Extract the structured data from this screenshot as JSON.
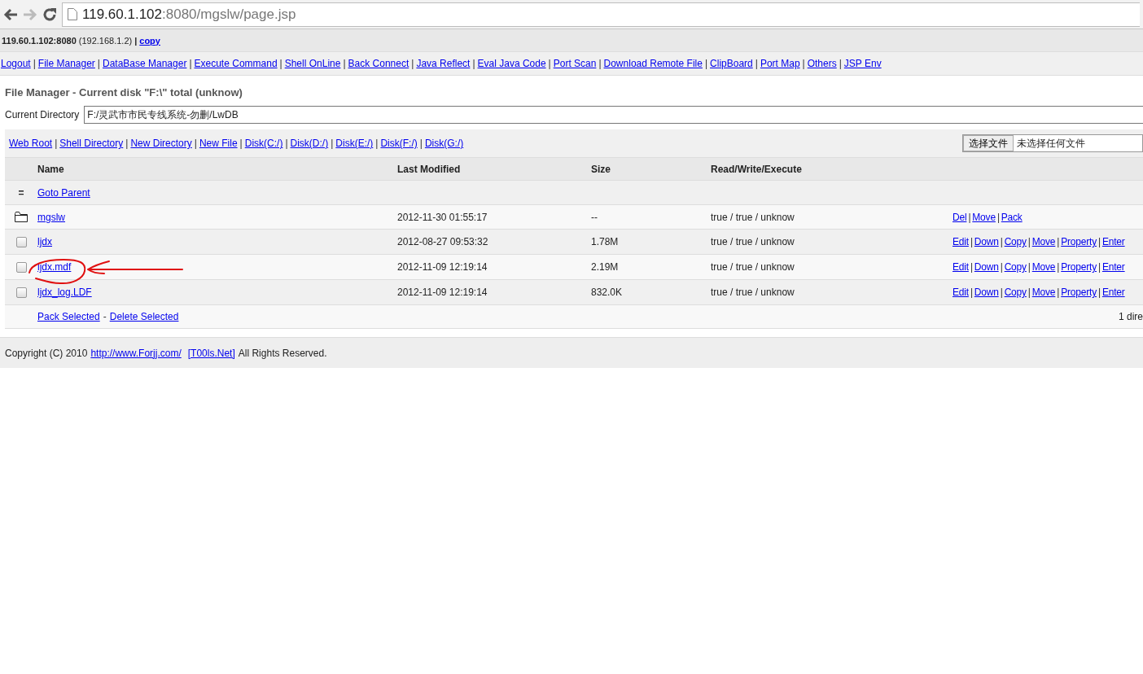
{
  "browser": {
    "url_host": "119.60.1.102",
    "url_rest": ":8080/mgslw/page.jsp"
  },
  "host_bar": {
    "host": "119.60.1.102:8080",
    "ip": "(192.168.1.2)",
    "separator": "|",
    "copy_link": "copy"
  },
  "nav": {
    "separator": "|",
    "links": [
      "Logout",
      "File Manager",
      "DataBase Manager",
      "Execute Command",
      "Shell OnLine",
      "Back Connect",
      "Java Reflect",
      "Eval Java Code",
      "Port Scan",
      "Download Remote File",
      "ClipBoard",
      "Port Map",
      "Others",
      "JSP Env"
    ]
  },
  "heading": "File Manager - Current disk \"F:\\\" total (unknow)",
  "current_directory": {
    "label": "Current Directory",
    "value": "F:/灵武市市民专线系统-勿删/LwDB"
  },
  "toolbar": {
    "separator": "|",
    "links": [
      "Web Root",
      "Shell Directory",
      "New Directory",
      "New File",
      "Disk(C:/)",
      "Disk(D:/)",
      "Disk(E:/)",
      "Disk(F:/)",
      "Disk(G:/)"
    ]
  },
  "file_picker": {
    "button": "选择文件",
    "status": "未选择任何文件"
  },
  "table": {
    "columns": [
      "Name",
      "Last Modified",
      "Size",
      "Read/Write/Execute"
    ],
    "parent_row": {
      "icon": "=",
      "label": "Goto Parent"
    },
    "action_separator": "|",
    "rows": [
      {
        "kind": "folder",
        "name": "mgslw",
        "modified": "2012-11-30 01:55:17",
        "size": "--",
        "rwx": "true / true / unknow",
        "actions": [
          "Del",
          "Move",
          "Pack"
        ],
        "annotated": false
      },
      {
        "kind": "file",
        "checked": false,
        "name": "ljdx",
        "modified": "2012-08-27 09:53:32",
        "size": "1.78M",
        "rwx": "true / true / unknow",
        "actions": [
          "Edit",
          "Down",
          "Copy",
          "Move",
          "Property",
          "Enter"
        ],
        "annotated": false
      },
      {
        "kind": "file",
        "checked": false,
        "name": "ljdx.mdf",
        "modified": "2012-11-09 12:19:14",
        "size": "2.19M",
        "rwx": "true / true / unknow",
        "actions": [
          "Edit",
          "Down",
          "Copy",
          "Move",
          "Property",
          "Enter"
        ],
        "annotated": true
      },
      {
        "kind": "file",
        "checked": false,
        "name": "ljdx_log.LDF",
        "modified": "2012-11-09 12:19:14",
        "size": "832.0K",
        "rwx": "true / true / unknow",
        "actions": [
          "Edit",
          "Down",
          "Copy",
          "Move",
          "Property",
          "Enter"
        ],
        "annotated": false
      }
    ],
    "footer": {
      "links": [
        "Pack Selected",
        "Delete Selected"
      ],
      "separator": "-",
      "summary": "1 dire"
    }
  },
  "copyright": {
    "prefix": "Copyright (C) 2010",
    "site_link": "http://www.Forjj.com/",
    "tools_link": "[T00ls.Net]",
    "suffix": "All Rights Reserved."
  }
}
